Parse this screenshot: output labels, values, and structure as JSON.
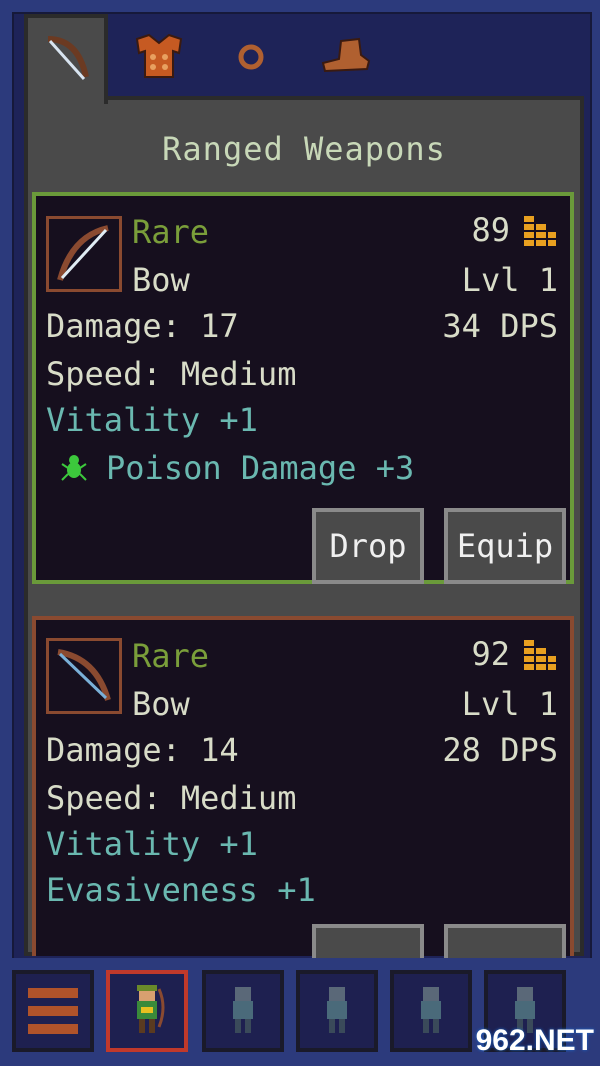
{
  "tabs": [
    {
      "icon": "bow-icon",
      "active": true
    },
    {
      "icon": "armor-icon",
      "active": false
    },
    {
      "icon": "ring-icon",
      "active": false
    },
    {
      "icon": "boots-icon",
      "active": false
    }
  ],
  "section_title": "Ranged Weapons",
  "items": [
    {
      "rarity": "Rare",
      "type": "Bow",
      "price": "89",
      "level": "Lvl 1",
      "damage": "Damage: 17",
      "dps": "34 DPS",
      "speed": "Speed: Medium",
      "stat1": "Vitality +1",
      "stat2": "Poison Damage +3",
      "drop_label": "Drop",
      "equip_label": "Equip"
    },
    {
      "rarity": "Rare",
      "type": "Bow",
      "price": "92",
      "level": "Lvl 1",
      "damage": "Damage: 14",
      "dps": "28 DPS",
      "speed": "Speed: Medium",
      "stat1": "Vitality +1",
      "stat2": "Evasiveness +1"
    }
  ],
  "colors": {
    "rarity": "#7a9e3a",
    "text": "#d8dcc8",
    "bonus": "#6ab8b0",
    "selected_border": "#c0392b"
  },
  "watermark": "962.NET"
}
